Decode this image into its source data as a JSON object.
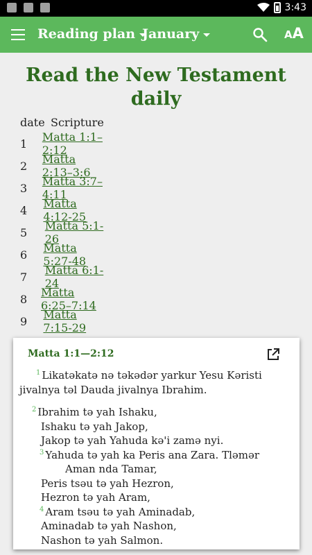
{
  "status": {
    "time": "3:43"
  },
  "appbar": {
    "menu_icon": "hamburger-menu-icon",
    "plan_label": "Reading plan",
    "month_label": "January",
    "search_icon": "search-icon",
    "font_icon": "font-size-icon",
    "font_small": "A",
    "font_large": "A",
    "color": "#5cb85c"
  },
  "page": {
    "title_line1": "Read the New Testament",
    "title_line2": "daily",
    "col_date": "date",
    "col_scripture": "Scripture",
    "rows": [
      {
        "date": "1",
        "ref": "Matta 1:1–2:12"
      },
      {
        "date": "2",
        "ref": "Matta 2:13–3:6"
      },
      {
        "date": "3",
        "ref": "Matta 3:7–4:11"
      },
      {
        "date": "4",
        "ref": "Matta 4:12-25"
      },
      {
        "date": "5",
        "ref": "Matta 5:1-26"
      },
      {
        "date": "6",
        "ref": "Matta 5:27-48"
      },
      {
        "date": "7",
        "ref": "Matta 6:1-24"
      },
      {
        "date": "8",
        "ref": "Matta 6:25–7:14"
      },
      {
        "date": "9",
        "ref": "Matta 7:15-29"
      }
    ]
  },
  "popup": {
    "reference": "Matta 1:1—2:12",
    "open_icon": "open-external-icon",
    "v1_num": "1",
    "v1_line1": "Likatəkatə nə təkədər yarkur Yesu Kəristi",
    "v1_line2": "jivalnya təl Dauda jivalnya Ibrahim.",
    "v2_num": "2",
    "v2_line1": "Ibrahim tə yah Ishaku,",
    "v2_line2": "Ishaku tə yah Jakop,",
    "v2_line3": "Jakop tə yah Yahuda kə'i zamə nyi.",
    "v3_num": "3",
    "v3_line1": "Yahuda tə yah ka Peris ana Zara. Tləmər",
    "v3_line2": "Aman nda Tamar,",
    "v3_line3": "Peris tsəu tə yah Hezron,",
    "v3_line4": "Hezron tə yah Aram,",
    "v4_num": "4",
    "v4_line1": "Aram tsəu tə yah Aminadab,",
    "v4_line2": "Aminadab tə yah Nashon,",
    "v4_line3": "Nashon tə yah Salmon."
  }
}
